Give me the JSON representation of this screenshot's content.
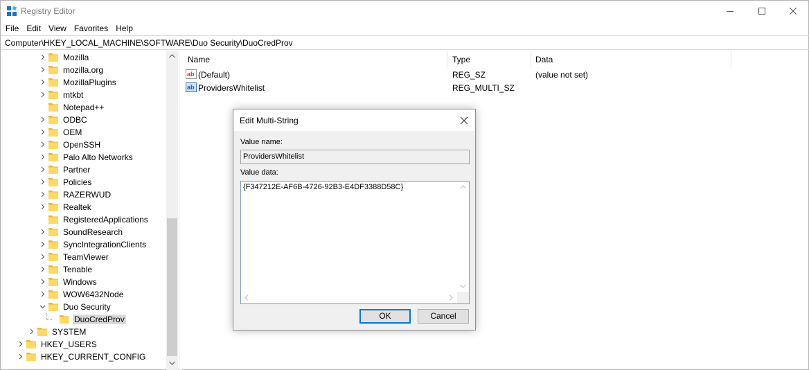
{
  "window": {
    "title": "Registry Editor",
    "controls": {
      "minimize": "—",
      "maximize": "☐",
      "close": "✕"
    }
  },
  "menu": [
    "File",
    "Edit",
    "View",
    "Favorites",
    "Help"
  ],
  "address": "Computer\\HKEY_LOCAL_MACHINE\\SOFTWARE\\Duo Security\\DuoCredProv",
  "tree": {
    "items": [
      {
        "label": "Mozilla",
        "expander": "collapsed"
      },
      {
        "label": "mozilla.org",
        "expander": "collapsed"
      },
      {
        "label": "MozillaPlugins",
        "expander": "collapsed"
      },
      {
        "label": "mtkbt",
        "expander": "collapsed"
      },
      {
        "label": "Notepad++",
        "expander": "none"
      },
      {
        "label": "ODBC",
        "expander": "collapsed"
      },
      {
        "label": "OEM",
        "expander": "collapsed"
      },
      {
        "label": "OpenSSH",
        "expander": "collapsed"
      },
      {
        "label": "Palo Alto Networks",
        "expander": "collapsed"
      },
      {
        "label": "Partner",
        "expander": "collapsed"
      },
      {
        "label": "Policies",
        "expander": "collapsed"
      },
      {
        "label": "RAZERWUD",
        "expander": "collapsed"
      },
      {
        "label": "Realtek",
        "expander": "collapsed"
      },
      {
        "label": "RegisteredApplications",
        "expander": "none"
      },
      {
        "label": "SoundResearch",
        "expander": "collapsed"
      },
      {
        "label": "SyncIntegrationClients",
        "expander": "collapsed"
      },
      {
        "label": "TeamViewer",
        "expander": "collapsed"
      },
      {
        "label": "Tenable",
        "expander": "collapsed"
      },
      {
        "label": "Windows",
        "expander": "collapsed"
      },
      {
        "label": "WOW6432Node",
        "expander": "collapsed"
      },
      {
        "label": "Duo Security",
        "expander": "expanded"
      },
      {
        "label": "DuoCredProv",
        "expander": "none",
        "selected": true
      },
      {
        "label": "SYSTEM",
        "expander": "collapsed"
      },
      {
        "label": "HKEY_USERS",
        "expander": "collapsed"
      },
      {
        "label": "HKEY_CURRENT_CONFIG",
        "expander": "collapsed"
      }
    ]
  },
  "list": {
    "columns": [
      "Name",
      "Type",
      "Data"
    ],
    "rows": [
      {
        "name": "(Default)",
        "type": "REG_SZ",
        "data": "(value not set)",
        "icon": "string-value-icon"
      },
      {
        "name": "ProvidersWhitelist",
        "type": "REG_MULTI_SZ",
        "data": "",
        "icon": "binary-value-icon"
      }
    ]
  },
  "dialog": {
    "title": "Edit Multi-String",
    "value_name_label": "Value name:",
    "value_name": "ProvidersWhitelist",
    "value_data_label": "Value data:",
    "value_data": "{F347212E-AF6B-4726-92B3-E4DF3388D58C}",
    "ok_label": "OK",
    "cancel_label": "Cancel"
  },
  "colors": {
    "folder": "#ffd966",
    "folder_dark": "#e8b732",
    "selection": "#d9d9d9",
    "accent": "#0078d7",
    "text_value_icon": "#d33a26",
    "binary_value_icon": "#3a7bd5"
  }
}
